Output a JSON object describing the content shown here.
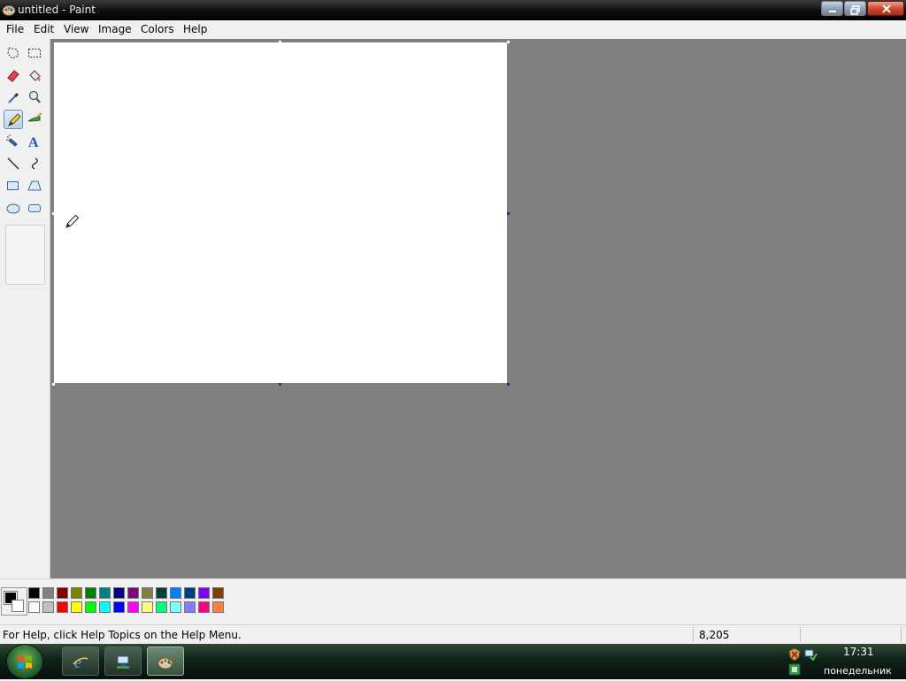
{
  "window": {
    "title": "untitled - Paint"
  },
  "menu": [
    "File",
    "Edit",
    "View",
    "Image",
    "Colors",
    "Help"
  ],
  "tools": [
    {
      "name": "free-form-select-icon"
    },
    {
      "name": "rect-select-icon"
    },
    {
      "name": "eraser-icon"
    },
    {
      "name": "fill-bucket-icon"
    },
    {
      "name": "color-picker-icon"
    },
    {
      "name": "magnifier-icon"
    },
    {
      "name": "pencil-icon",
      "active": true
    },
    {
      "name": "brush-icon"
    },
    {
      "name": "airbrush-icon"
    },
    {
      "name": "text-icon"
    },
    {
      "name": "line-icon"
    },
    {
      "name": "curve-icon"
    },
    {
      "name": "rectangle-icon"
    },
    {
      "name": "polygon-icon"
    },
    {
      "name": "ellipse-icon"
    },
    {
      "name": "rounded-rect-icon"
    }
  ],
  "palette": {
    "foreground": "#000000",
    "background": "#ffffff",
    "top_row": [
      "#000000",
      "#808080",
      "#800000",
      "#808000",
      "#008000",
      "#008080",
      "#000080",
      "#800080",
      "#808040",
      "#004040",
      "#0080ff",
      "#004080",
      "#8000ff",
      "#804000"
    ],
    "bottom_row": [
      "#ffffff",
      "#c0c0c0",
      "#ff0000",
      "#ffff00",
      "#00ff00",
      "#00ffff",
      "#0000ff",
      "#ff00ff",
      "#ffff80",
      "#00ff80",
      "#80ffff",
      "#8080ff",
      "#ff0080",
      "#ff8040"
    ]
  },
  "status": {
    "help_text": "For Help, click Help Topics on the Help Menu.",
    "coords": "8,205"
  },
  "taskbar": {
    "time": "17:31",
    "day": "понедельник"
  }
}
